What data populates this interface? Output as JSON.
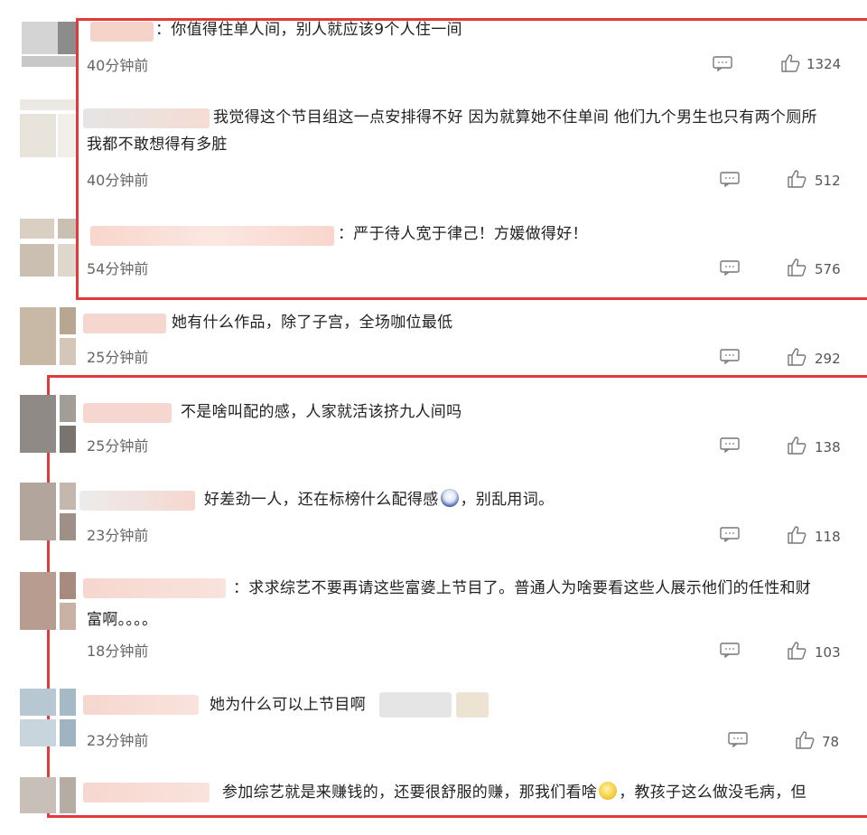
{
  "comments": [
    {
      "text": "：你值得住单人间，别人就应该9个人住一间",
      "time": "40分钟前",
      "likes": "1324"
    },
    {
      "text": "我觉得这个节目组这一点安排得不好 因为就算她不住单间 他们九个男生也只有两个厕所",
      "text2": "我都不敢想得有多脏",
      "time": "40分钟前",
      "likes": "512"
    },
    {
      "text": "：严于待人宽于律己！方媛做得好！",
      "time": "54分钟前",
      "likes": "576"
    },
    {
      "text": "她有什么作品，除了子宫，全场咖位最低",
      "time": "25分钟前",
      "likes": "292"
    },
    {
      "text": "不是啥叫配的感，人家就活该挤九人间吗",
      "time": "25分钟前",
      "likes": "138"
    },
    {
      "text": "好差劲一人，还在标榜什么配得感",
      "text_after": "，别乱用词。",
      "time": "23分钟前",
      "likes": "118"
    },
    {
      "text": "：求求综艺不要再请这些富婆上节目了。普通人为啥要看这些人展示他们的任性和财",
      "text2": "富啊。。。。",
      "time": "18分钟前",
      "likes": "103"
    },
    {
      "text": "她为什么可以上节目啊",
      "time": "23分钟前",
      "likes": "78"
    },
    {
      "text": "参加综艺就是来赚钱的，还要很舒服的赚，那我们看啥",
      "text_after": "，教孩子这么做没毛病，但"
    }
  ],
  "colors": {
    "highlight_border": "#e23a3a",
    "text": "#222222",
    "meta": "#666666"
  }
}
